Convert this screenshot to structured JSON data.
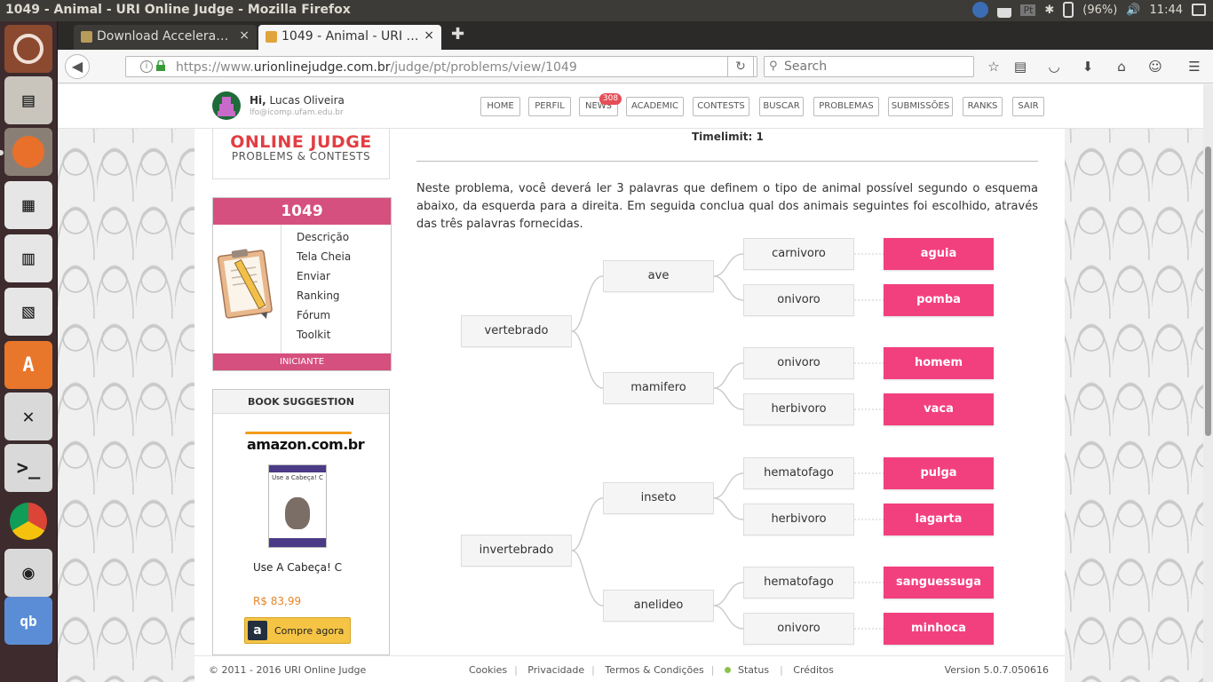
{
  "window": {
    "title": "1049 - Animal - URI Online Judge - Mozilla Firefox"
  },
  "tray": {
    "pt": "Pt",
    "battery": "(96%)",
    "clock": "11:44"
  },
  "tabs": [
    {
      "label": "Download Accelera…",
      "close": "×"
    },
    {
      "label": "1049 - Animal - URI …",
      "close": "×"
    }
  ],
  "newtab": "✚",
  "url": {
    "prefix": "https://www.",
    "domain": "urionlinejudge.com.br",
    "path": "/judge/pt/problems/view/1049"
  },
  "search": {
    "placeholder": "Search"
  },
  "user": {
    "hi": "Hi,",
    "name": " Lucas Oliveira",
    "email": "lfo@icomp.ufam.edu.br"
  },
  "menu": [
    "HOME",
    "PERFIL",
    "NEWS",
    "ACADEMIC",
    "CONTESTS",
    "BUSCAR",
    "PROBLEMAS",
    "SUBMISSÕES",
    "RANKS",
    "SAIR"
  ],
  "news_badge": "308",
  "logo": {
    "line1": "ONLINE JUDGE",
    "line2": "PROBLEMS & CONTESTS"
  },
  "problem": {
    "id": "1049",
    "links": [
      "Descrição",
      "Tela Cheia",
      "Enviar",
      "Ranking",
      "Fórum",
      "Toolkit"
    ],
    "level": "INICIANTE",
    "timelimit": "Timelimit: 1",
    "description": "Neste problema, você deverá ler 3 palavras que definem o tipo de animal possível segundo o esquema abaixo, da esquerda para a direita.  Em seguida conclua qual dos animais seguintes foi escolhido, através das três palavras fornecidas."
  },
  "book": {
    "header": "BOOK SUGGESTION",
    "store": "amazon.com.br",
    "cover_text": "Use a Cabeça! C",
    "title": "Use A Cabeça! C",
    "price": "R$ 83,99",
    "buy": "Compre agora"
  },
  "tree": {
    "root1": "vertebrado",
    "root2": "invertebrado",
    "mid": [
      "ave",
      "mamifero",
      "inseto",
      "anelideo"
    ],
    "third": [
      "carnivoro",
      "onivoro",
      "onivoro",
      "herbivoro",
      "hematofago",
      "herbivoro",
      "hematofago",
      "onivoro"
    ],
    "animals": [
      "aguia",
      "pomba",
      "homem",
      "vaca",
      "pulga",
      "lagarta",
      "sanguessuga",
      "minhoca"
    ]
  },
  "footer": {
    "copy": "© 2011 - 2016 URI Online Judge",
    "links": [
      "Cookies",
      "Privacidade",
      "Termos & Condições",
      "Status",
      "Créditos"
    ],
    "version": "Version 5.0.7.050616"
  },
  "colors": {
    "accent": "#d5507e",
    "leaf": "#f2407f",
    "logo": "#e23e42"
  }
}
